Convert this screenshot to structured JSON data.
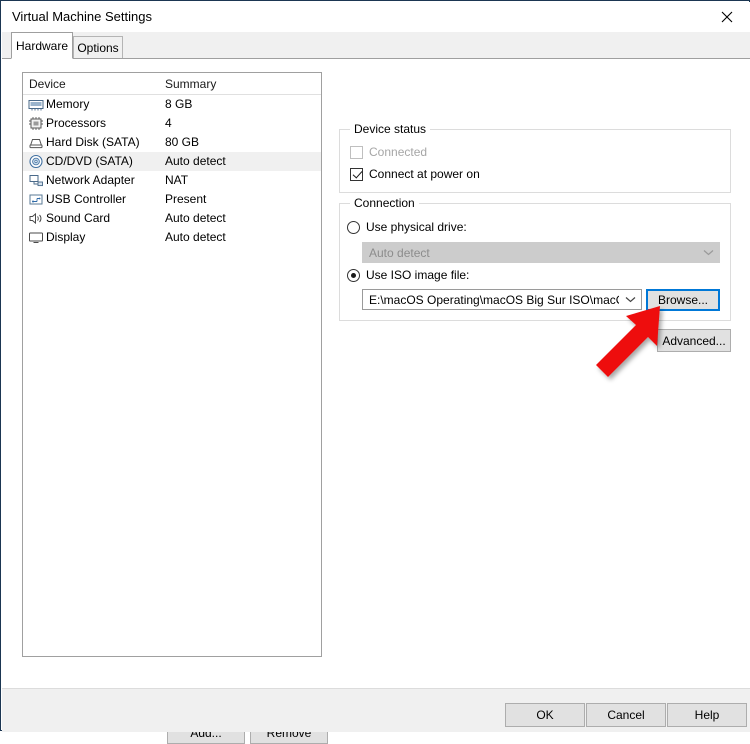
{
  "window": {
    "title": "Virtual Machine Settings",
    "close_icon": "close-icon"
  },
  "tabs": [
    {
      "label": "Hardware",
      "active": true
    },
    {
      "label": "Options",
      "active": false
    }
  ],
  "device_list": {
    "columns": [
      "Device",
      "Summary"
    ],
    "rows": [
      {
        "icon": "memory-icon",
        "device": "Memory",
        "summary": "8 GB",
        "selected": false
      },
      {
        "icon": "processor-icon",
        "device": "Processors",
        "summary": "4",
        "selected": false
      },
      {
        "icon": "hard-disk-icon",
        "device": "Hard Disk (SATA)",
        "summary": "80 GB",
        "selected": false
      },
      {
        "icon": "cd-dvd-icon",
        "device": "CD/DVD (SATA)",
        "summary": "Auto detect",
        "selected": true
      },
      {
        "icon": "network-adapter-icon",
        "device": "Network Adapter",
        "summary": "NAT",
        "selected": false
      },
      {
        "icon": "usb-controller-icon",
        "device": "USB Controller",
        "summary": "Present",
        "selected": false
      },
      {
        "icon": "sound-card-icon",
        "device": "Sound Card",
        "summary": "Auto detect",
        "selected": false
      },
      {
        "icon": "display-icon",
        "device": "Display",
        "summary": "Auto detect",
        "selected": false
      }
    ]
  },
  "list_buttons": {
    "add": "Add...",
    "remove": "Remove"
  },
  "device_status": {
    "title": "Device status",
    "connected": {
      "label": "Connected",
      "checked": false,
      "enabled": false
    },
    "connect_at_power_on": {
      "label": "Connect at power on",
      "checked": true,
      "enabled": true
    }
  },
  "connection": {
    "title": "Connection",
    "use_physical_drive": {
      "label": "Use physical drive:",
      "selected": false
    },
    "physical_drive_combo": {
      "value": "Auto detect",
      "enabled": false
    },
    "use_iso_image": {
      "label": "Use ISO image file:",
      "selected": true
    },
    "iso_combo": {
      "value": "E:\\macOS Operating\\macOS Big Sur ISO\\macOS Big",
      "enabled": true
    },
    "browse_button": "Browse...",
    "advanced_button": "Advanced..."
  },
  "annotation": {
    "arrow_color": "#ee1111",
    "points_at": "browse-button"
  },
  "footer": {
    "ok": "OK",
    "cancel": "Cancel",
    "help": "Help"
  },
  "colors": {
    "accent": "#0078d7",
    "window_border": "#1b3652",
    "selection": "#f0f0f0",
    "button_face": "#e1e1e1"
  }
}
